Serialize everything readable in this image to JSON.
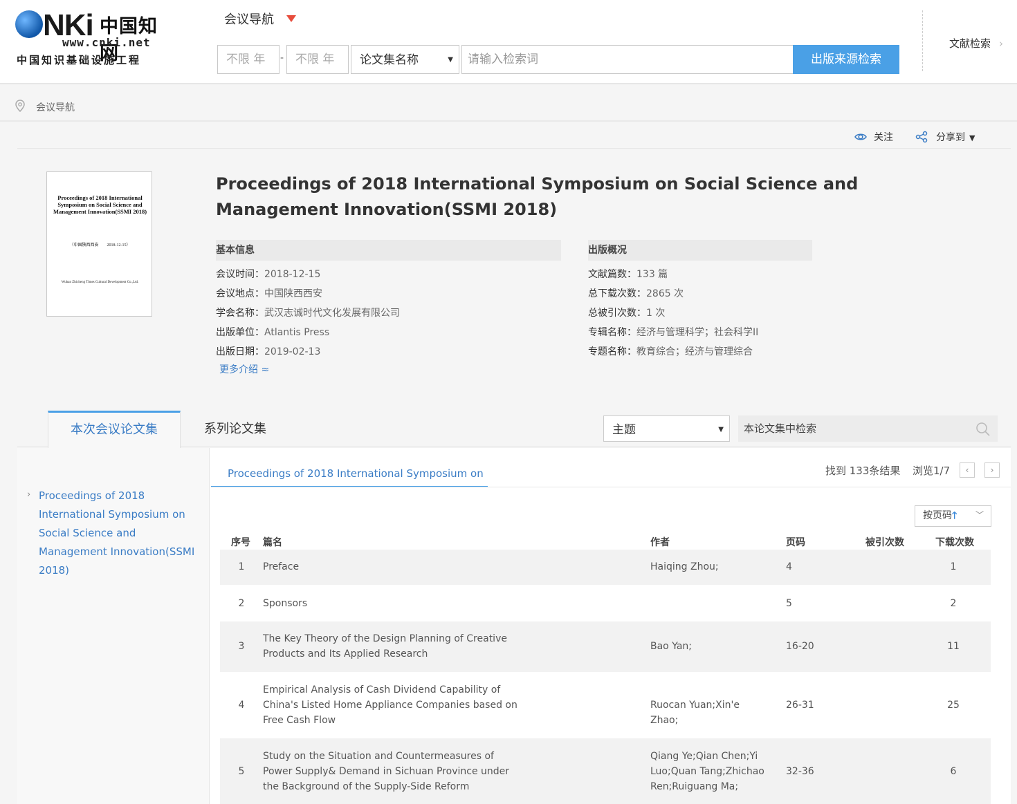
{
  "header": {
    "logo_brand": "CNKI",
    "logo_cn": "中国知网",
    "logo_url": "www.cnki.net",
    "logo_sub": "中国知识基础设施工程",
    "nav_title": "会议导航",
    "year_from_placeholder": "不限 年",
    "year_to_placeholder": "不限 年",
    "year_separator": "-",
    "field_select": "论文集名称",
    "search_placeholder": "请输入检索词",
    "search_button": "出版来源检索",
    "doc_search_link": "文献检索"
  },
  "breadcrumb": {
    "label": "会议导航"
  },
  "actions": {
    "follow": "关注",
    "share": "分享到"
  },
  "cover": {
    "title": "Proceedings of 2018 International Symposium on Social Science and Management Innovation(SSMI 2018)",
    "meta": "（中国陕西西安　　2018-12-15）",
    "publisher": "Wuhan Zhicheng Times Cultural Development Co.,Ltd."
  },
  "proceeding": {
    "title": "Proceedings of 2018 International Symposium on Social Science and Management Innovation(SSMI 2018)"
  },
  "basic_info": {
    "heading": "基本信息",
    "items": [
      {
        "key": "会议时间：",
        "value": "2018-12-15"
      },
      {
        "key": "会议地点：",
        "value": "中国陕西西安"
      },
      {
        "key": "学会名称：",
        "value": "武汉志诚时代文化发展有限公司"
      },
      {
        "key": "出版单位：",
        "value": "Atlantis Press"
      },
      {
        "key": "出版日期：",
        "value": "2019-02-13"
      }
    ],
    "more_link": "更多介绍"
  },
  "publish_overview": {
    "heading": "出版概况",
    "items": [
      {
        "key": "文献篇数：",
        "value": "133 篇"
      },
      {
        "key": "总下载次数：",
        "value": "2865 次"
      },
      {
        "key": "总被引次数：",
        "value": "1 次"
      },
      {
        "key": "专辑名称：",
        "value": "经济与管理科学；社会科学II"
      },
      {
        "key": "专题名称：",
        "value": "教育综合；经济与管理综合"
      }
    ]
  },
  "tabs": {
    "active": "本次会议论文集",
    "other": "系列论文集",
    "search_field": "主题",
    "search_placeholder": "本论文集中检索"
  },
  "sidebar": {
    "link": "Proceedings of 2018 International Symposium on Social Science and Management Innovation(SSMI 2018)"
  },
  "results": {
    "subtab": "Proceedings of 2018 International Symposium on ...",
    "found": "找到 133条结果",
    "pages": "浏览1/7",
    "sort_label": "按页码",
    "columns": [
      "序号",
      "篇名",
      "作者",
      "页码",
      "被引次数",
      "下载次数"
    ],
    "rows": [
      {
        "no": "1",
        "title": "Preface",
        "authors": "Haiqing Zhou;",
        "pages": "4",
        "cited": "",
        "downloads": "1"
      },
      {
        "no": "2",
        "title": "Sponsors",
        "authors": "",
        "pages": "5",
        "cited": "",
        "downloads": "2"
      },
      {
        "no": "3",
        "title": "The Key Theory of the Design Planning of Creative Products and Its Applied Research",
        "authors": "Bao Yan;",
        "pages": "16-20",
        "cited": "",
        "downloads": "11"
      },
      {
        "no": "4",
        "title": "Empirical Analysis of Cash Dividend Capability of China's Listed Home Appliance Companies based on Free Cash Flow",
        "authors": "Ruocan Yuan;Xin'e Zhao;",
        "pages": "26-31",
        "cited": "",
        "downloads": "25"
      },
      {
        "no": "5",
        "title": "Study on the Situation and Countermeasures of Power Supply& Demand in Sichuan Province under the Background of the Supply-Side Reform",
        "authors": "Qiang Ye;Qian Chen;Yi Luo;Quan Tang;Zhichao Ren;Ruiguang Ma;",
        "pages": "32-36",
        "cited": "",
        "downloads": "6"
      }
    ]
  }
}
